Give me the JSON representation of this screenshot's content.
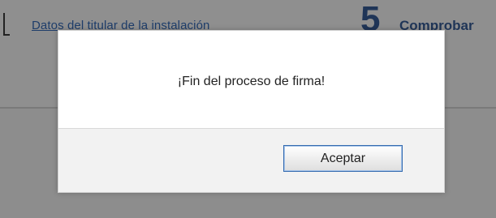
{
  "background": {
    "step_link_label": "Datos del titular de la instalación",
    "step_number": "5",
    "step_title": "Comprobar"
  },
  "dialog": {
    "message": "¡Fin del proceso de firma!",
    "accept_label": "Aceptar"
  },
  "colors": {
    "overlay": "#8f8f8f",
    "dialog_body": "#ffffff",
    "dialog_footer": "#f2f2f2",
    "button_border": "#356bb0",
    "step_accent": "#1f3557"
  }
}
